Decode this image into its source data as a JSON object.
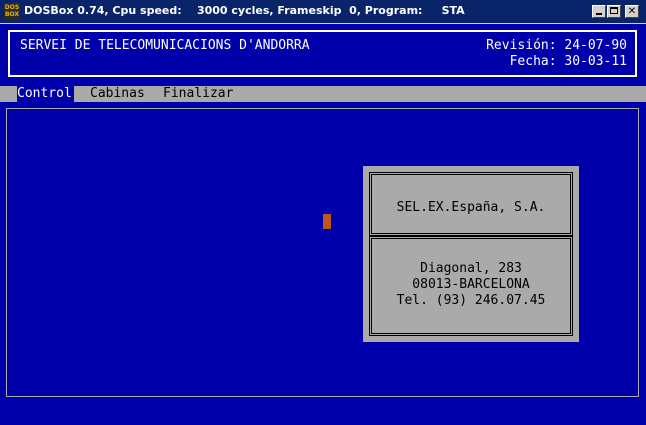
{
  "window": {
    "icon_text": "DOS BOX",
    "title": "DOSBox 0.74, Cpu speed:    3000 cycles, Frameskip  0, Program:     STA",
    "minimize_glyph": "_",
    "maximize_glyph": "□",
    "close_glyph": "✕"
  },
  "header": {
    "org_name": "SERVEI DE TELECOMUNICACIONS D'ANDORRA",
    "revision_line": "Revisión: 24-07-90",
    "fecha_line": "Fecha: 30-03-11"
  },
  "menu": {
    "items": [
      "Control",
      "Cabinas",
      "Finalizar"
    ]
  },
  "panel": {
    "company": "SEL.EX.España, S.A.",
    "address_lines": [
      "Diagonal, 283",
      "08013-BARCELONA",
      "Tel. (93) 246.07.45"
    ]
  },
  "colors": {
    "dos_background": "#0000aa",
    "menu_background": "#aaaaaa",
    "cursor": "#c0561c",
    "titlebar": "#0a246a"
  }
}
